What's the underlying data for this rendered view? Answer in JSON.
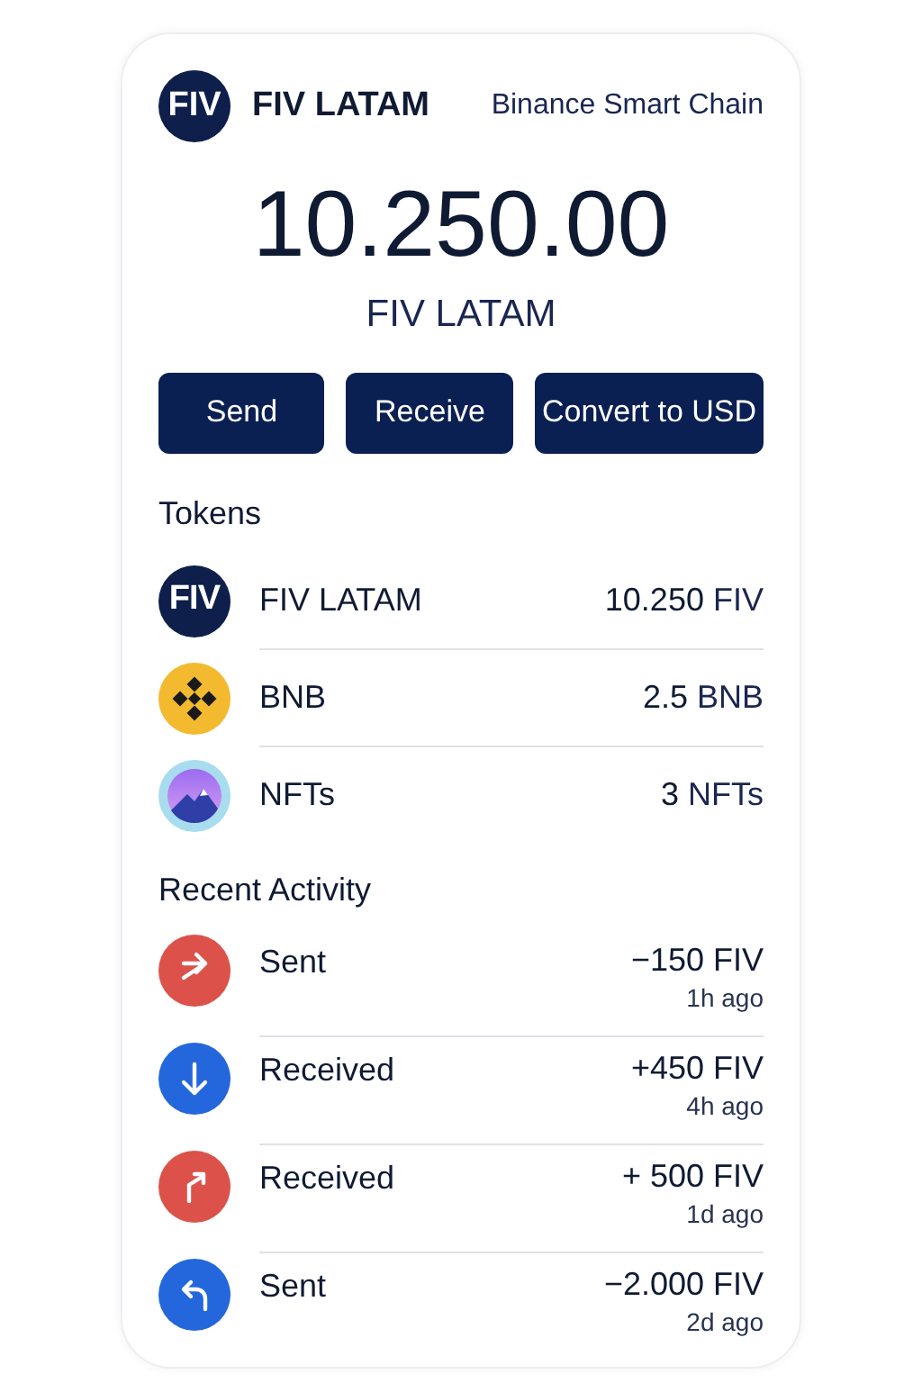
{
  "header": {
    "logo": "FIV",
    "title": "FIV LATAM",
    "network": "Binance Smart Chain"
  },
  "balance": {
    "amount": "10.250.00",
    "currency": "FIV LATAM"
  },
  "buttons": [
    "Send",
    "Receive",
    "Convert to USD"
  ],
  "tokens_title": "Tokens",
  "tokens": [
    {
      "kind": "fiv",
      "logo": "FIV",
      "name": "FIV LATAM",
      "amount": "10.250",
      "unit": "FIV"
    },
    {
      "kind": "bnb",
      "name": "BNB",
      "amount": "2.5",
      "unit": "BNB"
    },
    {
      "kind": "nft",
      "name": "NFTs",
      "amount": "3",
      "unit": "NFTs"
    }
  ],
  "activity_title": "Recent Activity",
  "activity": [
    {
      "kind": "right",
      "color": "#dc524a",
      "label": "Sent",
      "amount": "−150 FIV",
      "time": "1h ago"
    },
    {
      "kind": "down",
      "color": "#2467dc",
      "label": "Received",
      "amount": "+450 FIV",
      "time": "4h ago"
    },
    {
      "kind": "upturn",
      "color": "#dc524a",
      "label": "Received",
      "amount": "+ 500 FIV",
      "time": "1d ago"
    },
    {
      "kind": "left",
      "color": "#2467dc",
      "label": "Sent",
      "amount": "−2.000 FIV",
      "time": "2d ago"
    }
  ]
}
